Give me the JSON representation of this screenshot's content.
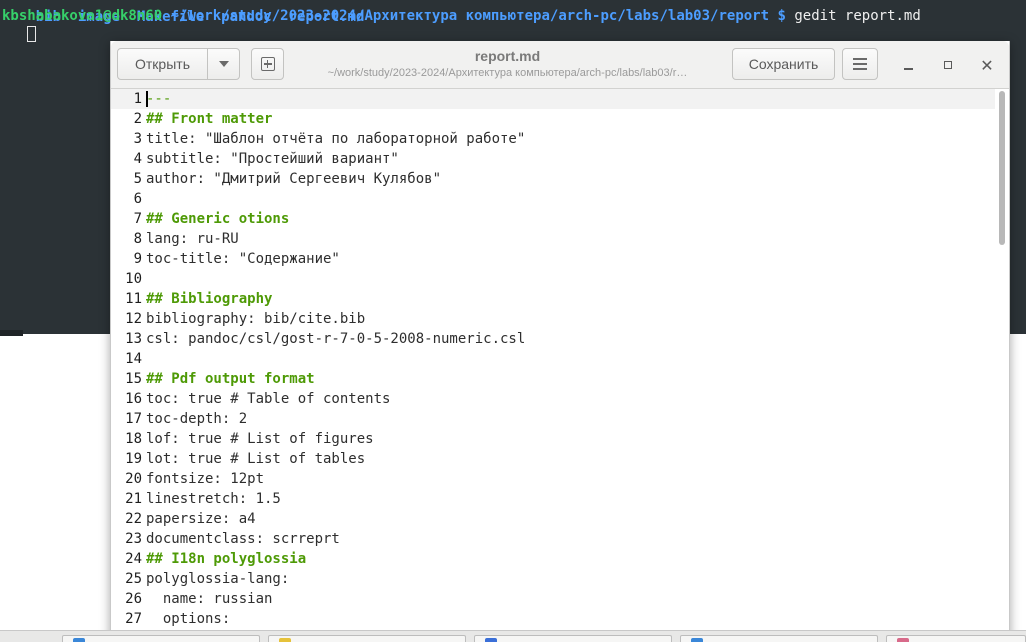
{
  "terminal": {
    "top_line": "bib  image  Makefile  pandoc  report.md",
    "user_host": "kbshabakova1@dk8n60",
    "cwd": "~/work/study/2023-2024/Архитектура компьютера/arch-pc/labs/lab03/report",
    "prompt_symbol": "$",
    "command": "gedit report.md"
  },
  "gedit": {
    "open_label": "Открыть",
    "save_label": "Сохранить",
    "title": "report.md",
    "subtitle": "~/work/study/2023-2024/Архитектура компьютера/arch-pc/labs/lab03/r…"
  },
  "editor": {
    "lines": [
      {
        "n": "1",
        "text": "---",
        "kind": "rule"
      },
      {
        "n": "2",
        "text": "## Front matter",
        "kind": "heading"
      },
      {
        "n": "3",
        "text": "title: \"Шаблон отчёта по лабораторной работе\"",
        "kind": "plain"
      },
      {
        "n": "4",
        "text": "subtitle: \"Простейший вариант\"",
        "kind": "plain"
      },
      {
        "n": "5",
        "text": "author: \"Дмитрий Сергеевич Кулябов\"",
        "kind": "plain"
      },
      {
        "n": "6",
        "text": "",
        "kind": "plain"
      },
      {
        "n": "7",
        "text": "## Generic otions",
        "kind": "heading"
      },
      {
        "n": "8",
        "text": "lang: ru-RU",
        "kind": "plain"
      },
      {
        "n": "9",
        "text": "toc-title: \"Содержание\"",
        "kind": "plain"
      },
      {
        "n": "10",
        "text": "",
        "kind": "plain"
      },
      {
        "n": "11",
        "text": "## Bibliography",
        "kind": "heading"
      },
      {
        "n": "12",
        "text": "bibliography: bib/cite.bib",
        "kind": "plain"
      },
      {
        "n": "13",
        "text": "csl: pandoc/csl/gost-r-7-0-5-2008-numeric.csl",
        "kind": "plain"
      },
      {
        "n": "14",
        "text": "",
        "kind": "plain"
      },
      {
        "n": "15",
        "text": "## Pdf output format",
        "kind": "heading"
      },
      {
        "n": "16",
        "text": "toc: true # Table of contents",
        "kind": "plain"
      },
      {
        "n": "17",
        "text": "toc-depth: 2",
        "kind": "plain"
      },
      {
        "n": "18",
        "text": "lof: true # List of figures",
        "kind": "plain"
      },
      {
        "n": "19",
        "text": "lot: true # List of tables",
        "kind": "plain"
      },
      {
        "n": "20",
        "text": "fontsize: 12pt",
        "kind": "plain"
      },
      {
        "n": "21",
        "text": "linestretch: 1.5",
        "kind": "plain"
      },
      {
        "n": "22",
        "text": "papersize: a4",
        "kind": "plain"
      },
      {
        "n": "23",
        "text": "documentclass: scrreprt",
        "kind": "plain"
      },
      {
        "n": "24",
        "text": "## I18n polyglossia",
        "kind": "heading"
      },
      {
        "n": "25",
        "text": "polyglossia-lang:",
        "kind": "plain"
      },
      {
        "n": "26",
        "text": "  name: russian",
        "kind": "plain"
      },
      {
        "n": "27",
        "text": "  options:",
        "kind": "plain"
      }
    ]
  },
  "taskbar": {
    "items": [
      {
        "icon_color": "#3a87d8"
      },
      {
        "icon_color": "#e6c23a"
      },
      {
        "icon_color": "#3a6fd8"
      },
      {
        "icon_color": "#3a87d8"
      },
      {
        "icon_color": "#d86a8a"
      }
    ]
  }
}
